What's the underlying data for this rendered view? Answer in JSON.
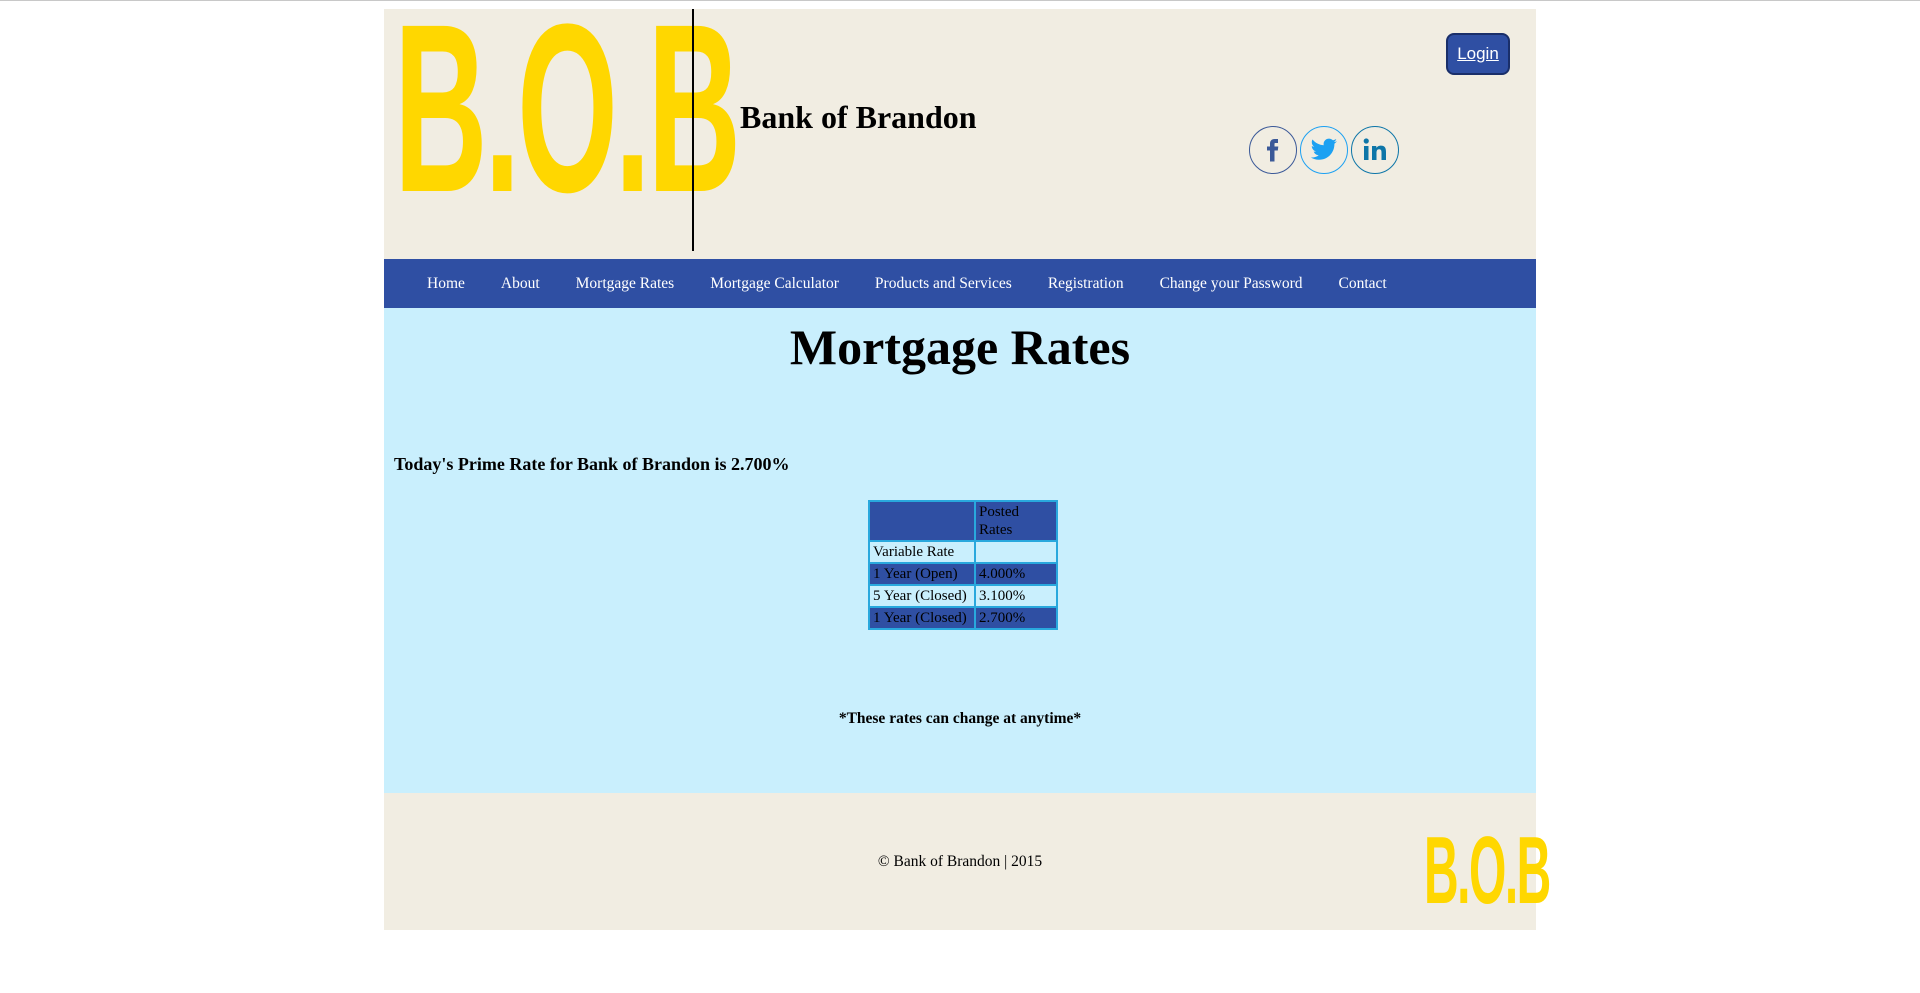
{
  "header": {
    "logo_text": "B.O.B",
    "site_title": "Bank of Brandon",
    "login_label": "Login",
    "social": [
      "facebook-icon",
      "twitter-icon",
      "linkedin-icon"
    ]
  },
  "nav": {
    "items": [
      {
        "label": "Home"
      },
      {
        "label": "About"
      },
      {
        "label": "Mortgage Rates"
      },
      {
        "label": "Mortgage Calculator"
      },
      {
        "label": "Products and Services"
      },
      {
        "label": "Registration"
      },
      {
        "label": "Change your Password"
      },
      {
        "label": "Contact"
      }
    ]
  },
  "main": {
    "title": "Mortgage Rates",
    "prime_rate_text": "Today's Prime Rate for Bank of Brandon is 2.700%",
    "table": {
      "header": [
        "",
        "Posted Rates"
      ],
      "rows": [
        {
          "term": "Variable Rate",
          "rate": ""
        },
        {
          "term": "1 Year (Open)",
          "rate": "4.000%"
        },
        {
          "term": "5 Year (Closed)",
          "rate": "3.100%"
        },
        {
          "term": "1 Year (Closed)",
          "rate": "2.700%"
        }
      ]
    },
    "note": "*These rates can change at anytime*"
  },
  "footer": {
    "copyright": "© Bank of Brandon | 2015",
    "logo_text": "B.O.B"
  },
  "colors": {
    "brand_blue": "#2f4fa3",
    "logo_yellow": "#ffd700",
    "content_bg": "#c9effd",
    "page_bg": "#f1ede2",
    "table_border": "#29a8dd"
  }
}
